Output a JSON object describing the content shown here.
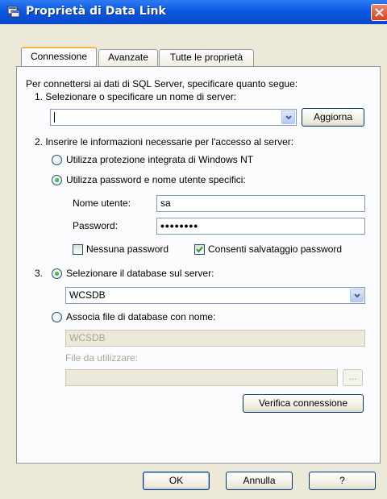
{
  "window": {
    "title": "Proprietà di Data Link"
  },
  "tabs": [
    {
      "label": "Connessione",
      "active": true
    },
    {
      "label": "Avanzate",
      "active": false
    },
    {
      "label": "Tutte le proprietà",
      "active": false
    }
  ],
  "connection": {
    "intro": "Per connettersi ai dati di SQL Server, specificare quanto segue:",
    "step1_label": "1. Selezionare o specificare un nome di server:",
    "server_value": "",
    "refresh_button": "Aggiorna",
    "step2_label": "2. Inserire le informazioni necessarie per l'accesso al server:",
    "auth_integrated": "Utilizza protezione integrata di Windows NT",
    "auth_specific": "Utilizza password e nome utente specifici:",
    "username_label": "Nome utente:",
    "username_value": "sa",
    "password_label": "Password:",
    "password_mask": "••••••••",
    "blank_password": "Nessuna password",
    "allow_saving": "Consenti salvataggio password",
    "step3_number": "3.",
    "select_db_label": "Selezionare il database sul server:",
    "database_value": "WCSDB",
    "attach_label": "Associa file di database con nome:",
    "attach_value": "WCSDB",
    "file_label": "File da utilizzare:",
    "file_value": "",
    "browse_button": "...",
    "test_button": "Verifica connessione"
  },
  "footer": {
    "ok": "OK",
    "cancel": "Annulla",
    "help": "?"
  },
  "colors": {
    "titlebar": "#0b59e3",
    "dialog_bg": "#ece9d8",
    "active_tab_accent": "#f5b44a"
  }
}
